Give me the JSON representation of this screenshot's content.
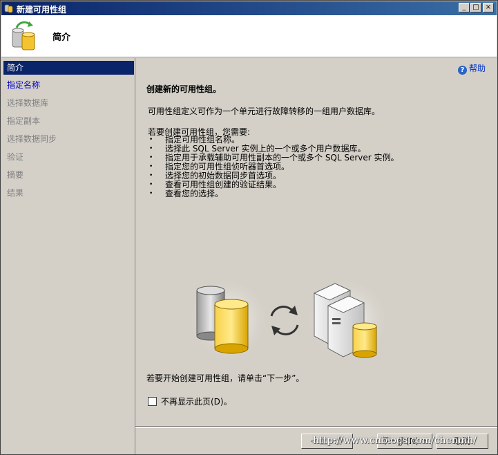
{
  "window": {
    "title": "新建可用性组",
    "controls": [
      "_",
      "□",
      "×"
    ]
  },
  "header": {
    "title": "简介"
  },
  "nav": {
    "items": [
      {
        "label": "简介",
        "state": "selected"
      },
      {
        "label": "指定名称",
        "state": "link"
      },
      {
        "label": "选择数据库",
        "state": "disabled"
      },
      {
        "label": "指定副本",
        "state": "disabled"
      },
      {
        "label": "选择数据同步",
        "state": "disabled"
      },
      {
        "label": "验证",
        "state": "disabled"
      },
      {
        "label": "摘要",
        "state": "disabled"
      },
      {
        "label": "结果",
        "state": "disabled"
      }
    ]
  },
  "content": {
    "help_label": "帮助",
    "heading": "创建新的可用性组。",
    "description": "可用性组定义可作为一个单元进行故障转移的一组用户数据库。",
    "requirements_intro": "若要创建可用性组，您需要:",
    "requirements": [
      "指定可用性组名称。",
      "选择此 SQL Server 实例上的一个或多个用户数据库。",
      "指定用于承载辅助可用性副本的一个或多个 SQL Server 实例。",
      "指定您的可用性组侦听器首选项。",
      "选择您的初始数据同步首选项。",
      "查看可用性组创建的验证结果。",
      "查看您的选择。"
    ],
    "start_text": "若要开始创建可用性组，请单击“下一步”。",
    "checkbox_label": "不再显示此页(D)。",
    "checkbox_checked": false
  },
  "footer": {
    "back_label": "< 上一步",
    "next_label": "下一步(N) >",
    "cancel_label": "取消"
  },
  "watermark": "http://www.cnblogs.com/chenmh/",
  "colors": {
    "title_bar": "#0a246a",
    "selected_nav": "#0a246a",
    "link": "#0000cc",
    "background": "#d4d0c8"
  }
}
